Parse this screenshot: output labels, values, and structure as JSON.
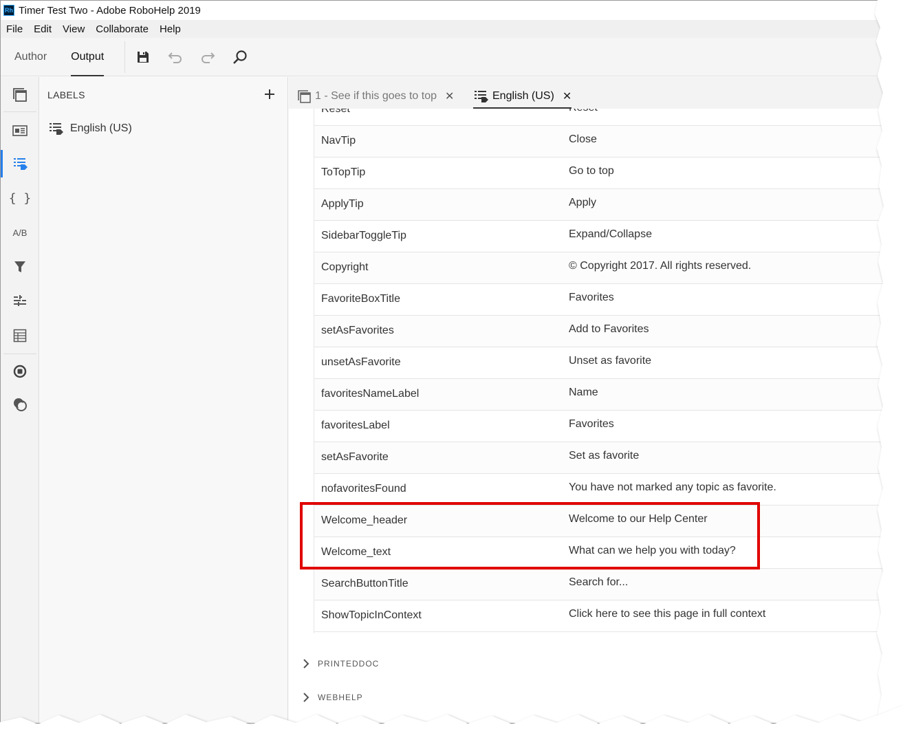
{
  "app": {
    "logo_text": "Rh",
    "window_title": "Timer Test Two - Adobe RoboHelp 2019"
  },
  "menu": [
    "File",
    "Edit",
    "View",
    "Collaborate",
    "Help"
  ],
  "toolbar": {
    "modes": [
      "Author",
      "Output"
    ],
    "active_mode": "Output",
    "icons": [
      "save-icon",
      "undo-icon",
      "redo-icon",
      "search-icon"
    ]
  },
  "left_rail": {
    "icons": [
      "output-presets-icon",
      "master-pages-icon",
      "labels-icon",
      "variables-icon",
      "ab-icon",
      "filter-icon",
      "map-files-icon",
      "table-icon",
      "stop-icon",
      "publish-icon"
    ],
    "ab_text": "A/B",
    "braces_text": "{ }",
    "active": "labels-icon"
  },
  "panel": {
    "title": "LABELS",
    "items": [
      {
        "label": "English (US)"
      }
    ]
  },
  "tabs": [
    {
      "label": "1 - See if this goes to top",
      "active": false
    },
    {
      "label": "English (US)",
      "active": true
    }
  ],
  "close_glyph": "✕",
  "label_rows": [
    {
      "key": "Reset",
      "value": "Reset"
    },
    {
      "key": "NavTip",
      "value": "Close"
    },
    {
      "key": "ToTopTip",
      "value": "Go to top"
    },
    {
      "key": "ApplyTip",
      "value": "Apply"
    },
    {
      "key": "SidebarToggleTip",
      "value": "Expand/Collapse"
    },
    {
      "key": "Copyright",
      "value": "© Copyright 2017. All rights reserved."
    },
    {
      "key": "FavoriteBoxTitle",
      "value": "Favorites"
    },
    {
      "key": "setAsFavorites",
      "value": "Add to Favorites"
    },
    {
      "key": "unsetAsFavorite",
      "value": "Unset as favorite"
    },
    {
      "key": "favoritesNameLabel",
      "value": "Name"
    },
    {
      "key": "favoritesLabel",
      "value": "Favorites"
    },
    {
      "key": "setAsFavorite",
      "value": "Set as favorite"
    },
    {
      "key": "nofavoritesFound",
      "value": "You have not marked any topic as favorite."
    },
    {
      "key": "Welcome_header",
      "value": "Welcome to our Help Center"
    },
    {
      "key": "Welcome_text",
      "value": "What can we help you with today?"
    },
    {
      "key": "SearchButtonTitle",
      "value": "Search for..."
    },
    {
      "key": "ShowTopicInContext",
      "value": "Click here to see this page in full context"
    }
  ],
  "highlighted_rows": [
    "Welcome_header",
    "Welcome_text"
  ],
  "highlight_color": "#e00000",
  "accent_color": "#2680eb",
  "sections": [
    {
      "label": "PRINTEDDOC",
      "expanded": false
    },
    {
      "label": "WEBHELP",
      "expanded": false
    }
  ]
}
